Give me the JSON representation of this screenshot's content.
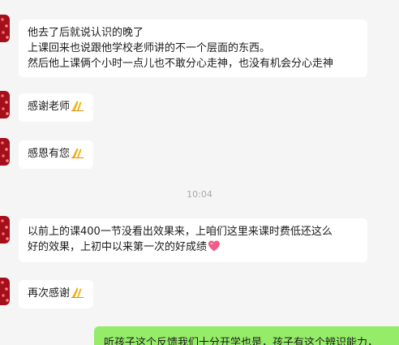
{
  "messages": [
    {
      "side": "left",
      "lines": [
        "他去了后就说认识的晚了",
        "上课回来也说跟他学校老师讲的不一个层面的东西。",
        "然后他上课俩个小时一点儿也不敢分心走神，也没有机会分心走神"
      ]
    },
    {
      "side": "left",
      "text": "感谢老师",
      "emoji": "pray-emoji"
    },
    {
      "side": "left",
      "text": "感恩有您",
      "emoji": "pray-emoji"
    },
    {
      "side": "left",
      "lines": [
        "以前上的课400一节没看出效果来，上咱们这里来课时费低还这么",
        "好的效果，上初中以来第一次的好成绩"
      ],
      "emoji": "pink-heart-emoji"
    },
    {
      "side": "left",
      "text": "再次感谢",
      "emoji": "pray-emoji"
    },
    {
      "side": "right",
      "text": "听孩子这个反馈我们十分开学也是，孩子有这个辨识能力，"
    }
  ],
  "timestamp": "10:04",
  "colors": {
    "background": "#f5f5f5",
    "incoming_bubble": "#ffffff",
    "outgoing_bubble": "#95ec69",
    "avatar": "#a3101b",
    "timestamp_text": "#a8a8a8",
    "heart": "#f25c8a",
    "pray": "#f2b21b"
  }
}
